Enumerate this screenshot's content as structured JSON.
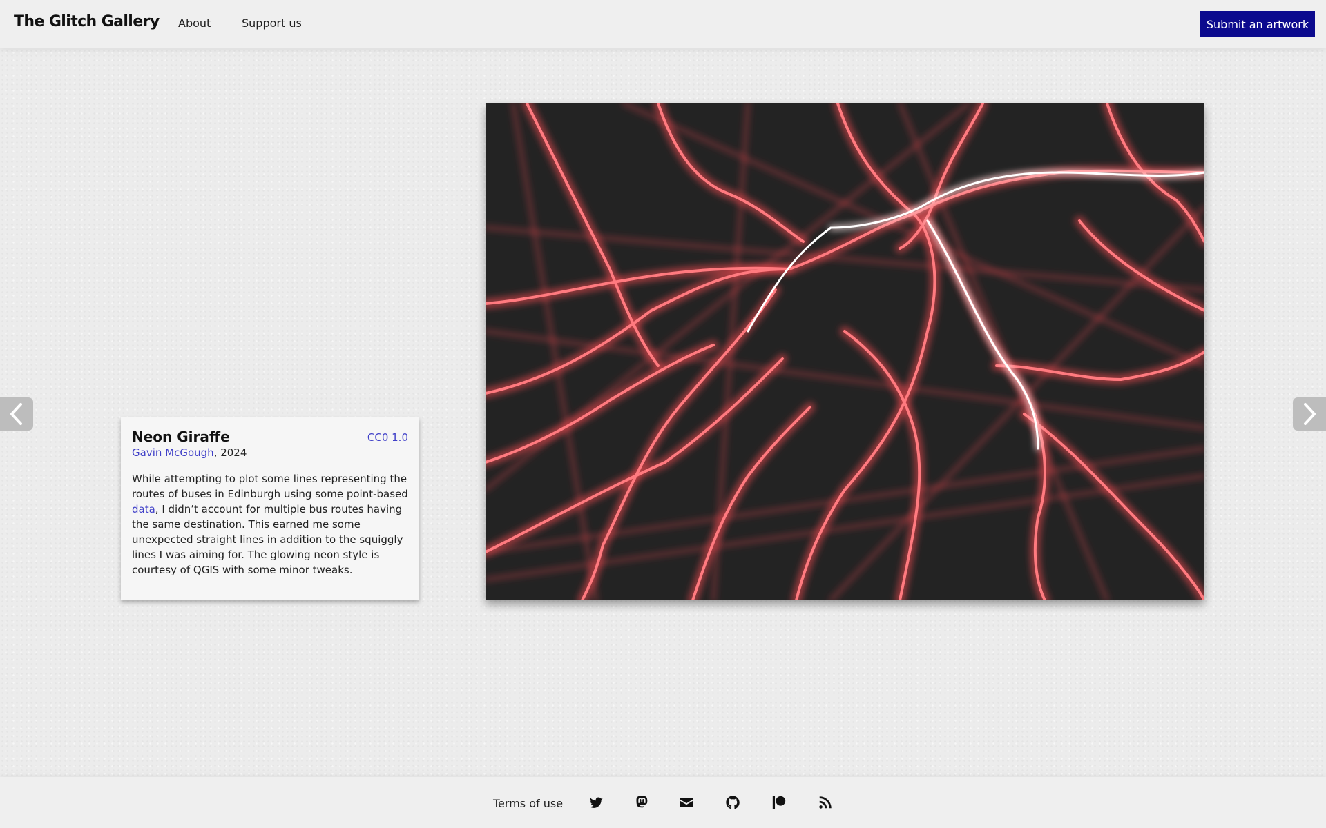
{
  "header": {
    "logo": "The Glitch Gallery",
    "nav": [
      {
        "label": "About"
      },
      {
        "label": "Support us"
      }
    ],
    "submit_label": "Submit an artwork"
  },
  "navigation": {
    "prev_icon": "chevron-left-icon",
    "next_icon": "chevron-right-icon"
  },
  "artwork": {
    "title": "Neon Giraffe",
    "license": "CC0 1.0",
    "artist": "Gavin McGough",
    "year": ", 2024",
    "description_before": "While attempting to plot some lines representing the routes of buses in Edinburgh using some point-based ",
    "description_link": "data",
    "description_after": ", I didn’t account for multiple bus routes having the same destination. This earned me some unexpected straight lines in addition to the squiggly lines I was aiming for. The glowing neon style is courtesy of QGIS with some minor tweaks.",
    "image_colors": {
      "background": "#232323",
      "glow": "#ff4a52",
      "core": "#ffe6e6"
    }
  },
  "footer": {
    "terms_label": "Terms of use",
    "icons": [
      "twitter-icon",
      "mastodon-icon",
      "email-icon",
      "github-icon",
      "patreon-icon",
      "rss-icon"
    ]
  },
  "colors": {
    "accent": "#0c0a8e",
    "link": "#4040c8",
    "page_background": "#ececec"
  }
}
